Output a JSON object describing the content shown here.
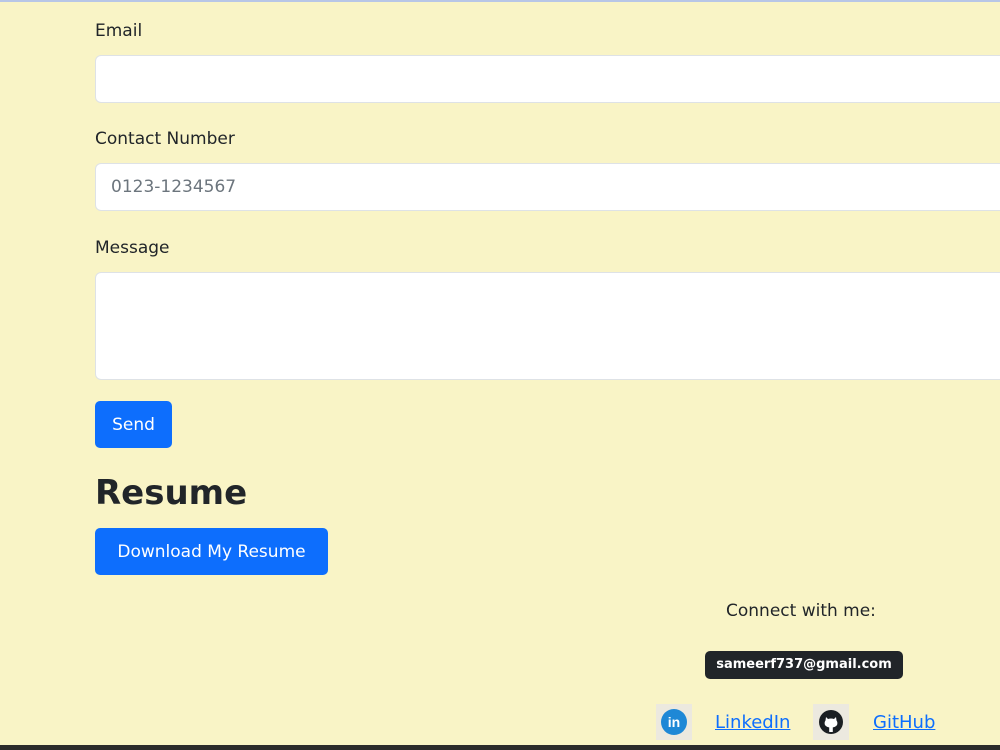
{
  "form": {
    "email_label": "Email",
    "email_value": "",
    "contact_label": "Contact Number",
    "contact_placeholder": "0123-1234567",
    "message_label": "Message",
    "message_value": "",
    "send_label": "Send"
  },
  "resume": {
    "title": "Resume",
    "download_label": "Download My Resume"
  },
  "footer": {
    "connect_text": "Connect with me:",
    "email_badge": "sameerf737@gmail.com",
    "links": [
      {
        "label": "LinkedIn",
        "icon": "linkedin-icon"
      },
      {
        "label": "GitHub",
        "icon": "github-icon"
      }
    ]
  },
  "colors": {
    "background": "#f9f4c6",
    "primary": "#0d6efd",
    "badge": "#212529"
  }
}
